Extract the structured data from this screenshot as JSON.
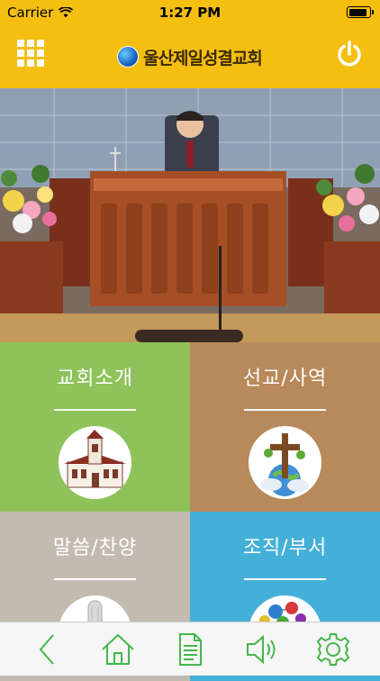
{
  "status_bar": {
    "carrier": "Carrier",
    "time": "1:27 PM",
    "battery_level": 0.95
  },
  "header": {
    "logo_text": "울산제일성결교회"
  },
  "hero": {
    "slide_count": 5,
    "active_slide": 2
  },
  "tiles": [
    {
      "title": "교회소개",
      "icon": "church-building-icon",
      "color": "#8fc25b"
    },
    {
      "title": "선교/사역",
      "icon": "cross-globe-icon",
      "color": "#b8895a"
    },
    {
      "title": "말씀/찬양",
      "icon": "microphone-icon",
      "color": "#c1bbb0"
    },
    {
      "title": "조직/부서",
      "icon": "molecule-icon",
      "color": "#44b0d8"
    }
  ],
  "tab_bar": {
    "accent": "#45b649",
    "items": [
      "back-icon",
      "home-icon",
      "document-icon",
      "speaker-icon",
      "settings-gear-icon"
    ]
  }
}
